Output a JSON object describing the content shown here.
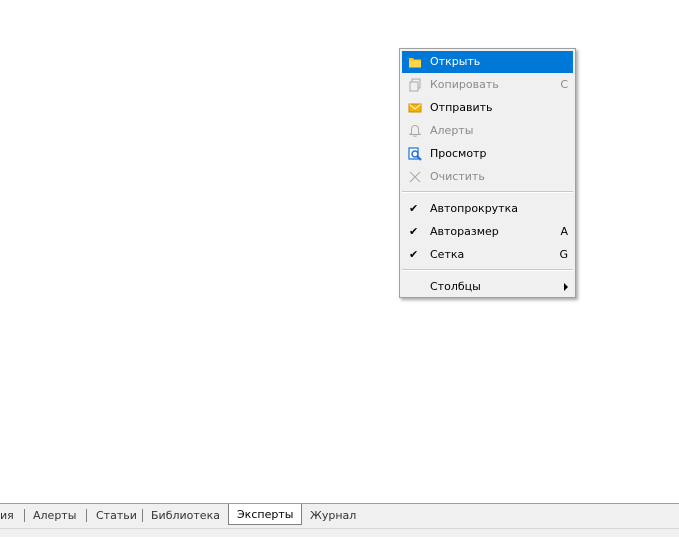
{
  "context_menu": {
    "items": [
      {
        "label": "Открыть",
        "icon": "folder-icon",
        "shortcut": "",
        "disabled": false,
        "highlighted": true
      },
      {
        "label": "Копировать",
        "icon": "copy-icon",
        "shortcut": "C",
        "disabled": true
      },
      {
        "label": "Отправить",
        "icon": "mail-icon",
        "shortcut": "",
        "disabled": false
      },
      {
        "label": "Алерты",
        "icon": "bell-icon",
        "shortcut": "",
        "disabled": true
      },
      {
        "label": "Просмотр",
        "icon": "preview-icon",
        "shortcut": "",
        "disabled": false
      },
      {
        "label": "Очистить",
        "icon": "clear-icon",
        "shortcut": "",
        "disabled": true
      },
      {
        "label": "Автопрокрутка",
        "checked": true,
        "shortcut": ""
      },
      {
        "label": "Авторазмер",
        "checked": true,
        "shortcut": "A"
      },
      {
        "label": "Сетка",
        "checked": true,
        "shortcut": "G"
      },
      {
        "label": "Столбцы",
        "submenu": true,
        "shortcut": ""
      }
    ]
  },
  "tabs": [
    {
      "label": "ия",
      "active": false
    },
    {
      "label": "Алерты",
      "active": false
    },
    {
      "label": "Статьи",
      "active": false
    },
    {
      "label": "Библиотека",
      "active": false
    },
    {
      "label": "Эксперты",
      "active": true
    },
    {
      "label": "Журнал",
      "active": false
    }
  ],
  "colors": {
    "highlight": "#0078d7",
    "folder": "#f0c000",
    "mail": "#f0b400",
    "preview": "#1e6fd9",
    "disabled": "#8a8a8a"
  }
}
